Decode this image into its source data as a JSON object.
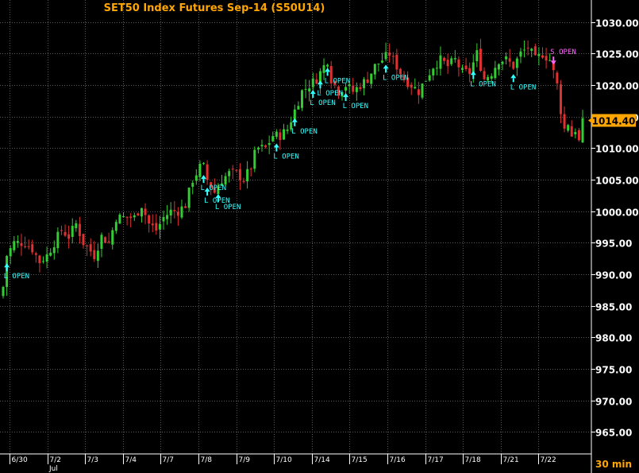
{
  "chart_data": {
    "type": "candlestick",
    "title": "SET50  Index Futures Sep-14  (S50U14)",
    "interval_label": "30  min",
    "month_label": "Jul",
    "last_price_label": "1014.40",
    "last_price": 1014.4,
    "ylim": [
      961.5,
      1033.5
    ],
    "y_ticks": [
      1030,
      1025,
      1020,
      1015,
      1010,
      1005,
      1000,
      995,
      990,
      985,
      980,
      975,
      970,
      965
    ],
    "y_tick_labels": [
      "1030.00",
      "1025.00",
      "1020.00",
      "1015.00",
      "1010.00",
      "1005.00",
      "1000.00",
      "995.00",
      "990.00",
      "985.00",
      "980.00",
      "975.00",
      "970.00",
      "965.00"
    ],
    "x_labels": [
      "6/30",
      "7/2",
      "7/3",
      "7/4",
      "7/7",
      "7/8",
      "7/9",
      "7/10",
      "7/14",
      "7/15",
      "7/16",
      "7/17",
      "7/18",
      "7/21",
      "7/22"
    ],
    "grid": true,
    "colors": {
      "up": "#33cc33",
      "down": "#e03030",
      "long_signal": "#33ffff",
      "short_signal": "#ff66ff",
      "title": "#ffa600",
      "grid": "#5a5a5a",
      "price_tag": "#ffa600"
    },
    "anchor_closes": [
      [
        0,
        988
      ],
      [
        1,
        993
      ],
      [
        3,
        995
      ],
      [
        6,
        995
      ],
      [
        8,
        994
      ],
      [
        10,
        992
      ],
      [
        12,
        993
      ],
      [
        14,
        995
      ],
      [
        16,
        997
      ],
      [
        18,
        996
      ],
      [
        20,
        998
      ],
      [
        22,
        995
      ],
      [
        25,
        993
      ],
      [
        27,
        996
      ],
      [
        29,
        995
      ],
      [
        31,
        999
      ],
      [
        33,
        999
      ],
      [
        36,
        999
      ],
      [
        38,
        1001
      ],
      [
        40,
        998
      ],
      [
        42,
        997
      ],
      [
        44,
        999
      ],
      [
        46,
        1000
      ],
      [
        48,
        1000
      ],
      [
        50,
        1001
      ],
      [
        51,
        1003
      ],
      [
        52,
        1005
      ],
      [
        53,
        1006
      ],
      [
        54,
        1007
      ],
      [
        55,
        1007
      ],
      [
        56,
        1005
      ],
      [
        57,
        1004
      ],
      [
        58,
        1003
      ],
      [
        60,
        1005
      ],
      [
        62,
        1006
      ],
      [
        64,
        1006
      ],
      [
        66,
        1005
      ],
      [
        68,
        1007
      ],
      [
        69,
        1009
      ],
      [
        70,
        1010
      ],
      [
        72,
        1010
      ],
      [
        74,
        1012
      ],
      [
        76,
        1012
      ],
      [
        78,
        1013
      ],
      [
        80,
        1016
      ],
      [
        82,
        1019
      ],
      [
        84,
        1020
      ],
      [
        86,
        1021
      ],
      [
        88,
        1023
      ],
      [
        89,
        1024
      ],
      [
        90,
        1021
      ],
      [
        92,
        1019
      ],
      [
        94,
        1020
      ],
      [
        96,
        1019
      ],
      [
        98,
        1020
      ],
      [
        100,
        1021
      ],
      [
        102,
        1023
      ],
      [
        104,
        1024
      ],
      [
        106,
        1025
      ],
      [
        108,
        1023
      ],
      [
        110,
        1021
      ],
      [
        112,
        1020
      ],
      [
        114,
        1019
      ],
      [
        116,
        1021
      ],
      [
        118,
        1023
      ],
      [
        120,
        1024
      ],
      [
        122,
        1023
      ],
      [
        124,
        1024
      ],
      [
        126,
        1022
      ],
      [
        128,
        1022
      ],
      [
        130,
        1025
      ],
      [
        132,
        1021
      ],
      [
        134,
        1022
      ],
      [
        136,
        1024
      ],
      [
        138,
        1024
      ],
      [
        140,
        1023
      ],
      [
        142,
        1025
      ],
      [
        144,
        1026
      ],
      [
        146,
        1024
      ],
      [
        148,
        1025
      ],
      [
        150,
        1024
      ],
      [
        151,
        1022
      ],
      [
        152,
        1020
      ],
      [
        153,
        1016
      ],
      [
        154,
        1013
      ],
      [
        155,
        1014
      ],
      [
        156,
        1012
      ],
      [
        157,
        1013
      ],
      [
        158,
        1011
      ],
      [
        159,
        1014
      ]
    ],
    "signals": [
      {
        "type": "long",
        "bar": 1,
        "label": "L OPEN"
      },
      {
        "type": "long",
        "bar": 55,
        "label": "L OPEN"
      },
      {
        "type": "long",
        "bar": 56,
        "label": "L OPEN"
      },
      {
        "type": "long",
        "bar": 59,
        "label": "L OPEN"
      },
      {
        "type": "long",
        "bar": 75,
        "label": "L OPEN"
      },
      {
        "type": "long",
        "bar": 80,
        "label": "L OPEN"
      },
      {
        "type": "long",
        "bar": 85,
        "label": "L OPEN"
      },
      {
        "type": "long",
        "bar": 87,
        "label": "L OPEN"
      },
      {
        "type": "long",
        "bar": 89,
        "label": "L OPEN"
      },
      {
        "type": "long",
        "bar": 94,
        "label": "L OPEN"
      },
      {
        "type": "long",
        "bar": 105,
        "label": "L OPEN"
      },
      {
        "type": "long",
        "bar": 129,
        "label": "L OPEN"
      },
      {
        "type": "long",
        "bar": 140,
        "label": "L OPEN"
      },
      {
        "type": "short",
        "bar": 151,
        "label": "S OPEN"
      }
    ]
  }
}
